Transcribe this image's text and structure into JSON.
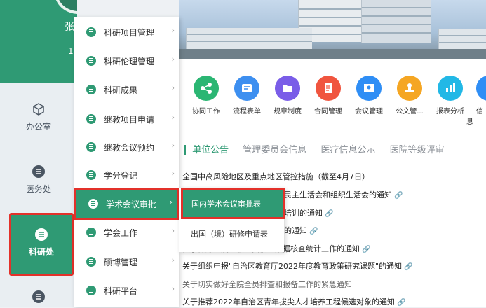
{
  "profile": {
    "name": "张",
    "id_prefix": "1",
    "verified_icon": "check-icon"
  },
  "leftnav": [
    {
      "label": "办公室",
      "icon": "cube-icon"
    },
    {
      "label": "医务处",
      "icon": "list-icon"
    },
    {
      "label": "科研处",
      "icon": "list-icon",
      "active": true
    }
  ],
  "menu": [
    {
      "label": "科研项目管理"
    },
    {
      "label": "科研伦理管理"
    },
    {
      "label": "科研成果"
    },
    {
      "label": "继教项目申请"
    },
    {
      "label": "继教会议预约"
    },
    {
      "label": "学分登记"
    },
    {
      "label": "学术会议审批",
      "selected": true
    },
    {
      "label": "学会工作"
    },
    {
      "label": "硕博管理"
    },
    {
      "label": "科研平台"
    }
  ],
  "submenu": [
    {
      "label": "国内学术会议审批表",
      "selected": true
    },
    {
      "label": "出国（境）研修申请表"
    }
  ],
  "apps": [
    {
      "label": "协同工作",
      "color": "#2bb673",
      "icon": "share-icon"
    },
    {
      "label": "流程表单",
      "color": "#3d8ff0",
      "icon": "form-icon"
    },
    {
      "label": "规章制度",
      "color": "#7a5de8",
      "icon": "folder-icon"
    },
    {
      "label": "合同管理",
      "color": "#f0553f",
      "icon": "document-icon"
    },
    {
      "label": "会议管理",
      "color": "#2f8ef5",
      "icon": "meeting-icon"
    },
    {
      "label": "公文管...",
      "color": "#f5a623",
      "icon": "stamp-icon"
    },
    {
      "label": "报表分析",
      "color": "#22b8e6",
      "icon": "chart-icon"
    },
    {
      "label": "信息",
      "color": "#2f8ef5",
      "icon": "info-icon"
    }
  ],
  "tabs": [
    "单位公告",
    "管理委员会信息",
    "医疗信息公示",
    "医院等级评审"
  ],
  "notices": [
    {
      "text": "全国中高风险地区及重点地区管控措施（截至4月7日）",
      "clip": false
    },
    {
      "text": "民主生活会和组织生活会的通知",
      "clip": true
    },
    {
      "text": "培训的通知",
      "clip": true
    },
    {
      "text": "的通知",
      "clip": true
    },
    {
      "text": "关于做好全院在职人员信息数据核查统计工作的通知",
      "clip": true
    },
    {
      "text": "关于组织申报\"自治区教育厅2022年度教育政策研究课题\"的通知",
      "clip": true
    },
    {
      "text": "关于切实做好全院全员排查和报备工作的紧急通知",
      "clip": false
    },
    {
      "text": "关于推荐2022年自治区青年拔尖人才培养工程候选对象的通知",
      "clip": true
    }
  ],
  "colors": {
    "brand": "#2f9a74",
    "highlight_border": "#e3312a"
  }
}
